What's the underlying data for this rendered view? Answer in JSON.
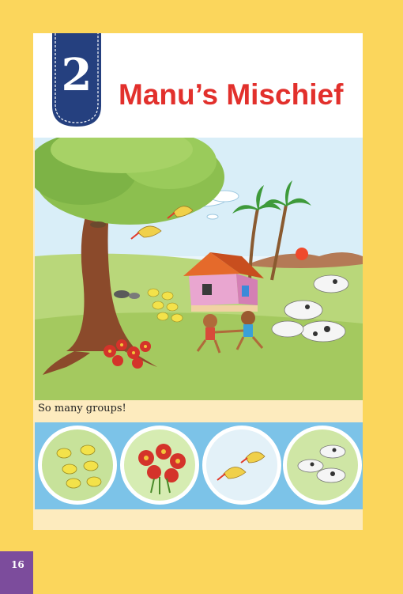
{
  "chapter": {
    "number": "2",
    "title": "Manu’s Mischief"
  },
  "illustration": {
    "caption": "So many groups!"
  },
  "groups_strip": {
    "items": [
      "chicks-group",
      "flowers-group",
      "birds-group",
      "goats-group"
    ]
  },
  "page_number": "16",
  "colors": {
    "background": "#fbd65c",
    "page": "#fdebbe",
    "title_red": "#e2302c",
    "tab_blue": "#25407f",
    "strip_blue": "#7cc3e8",
    "page_number_purple": "#7c4c9c"
  }
}
